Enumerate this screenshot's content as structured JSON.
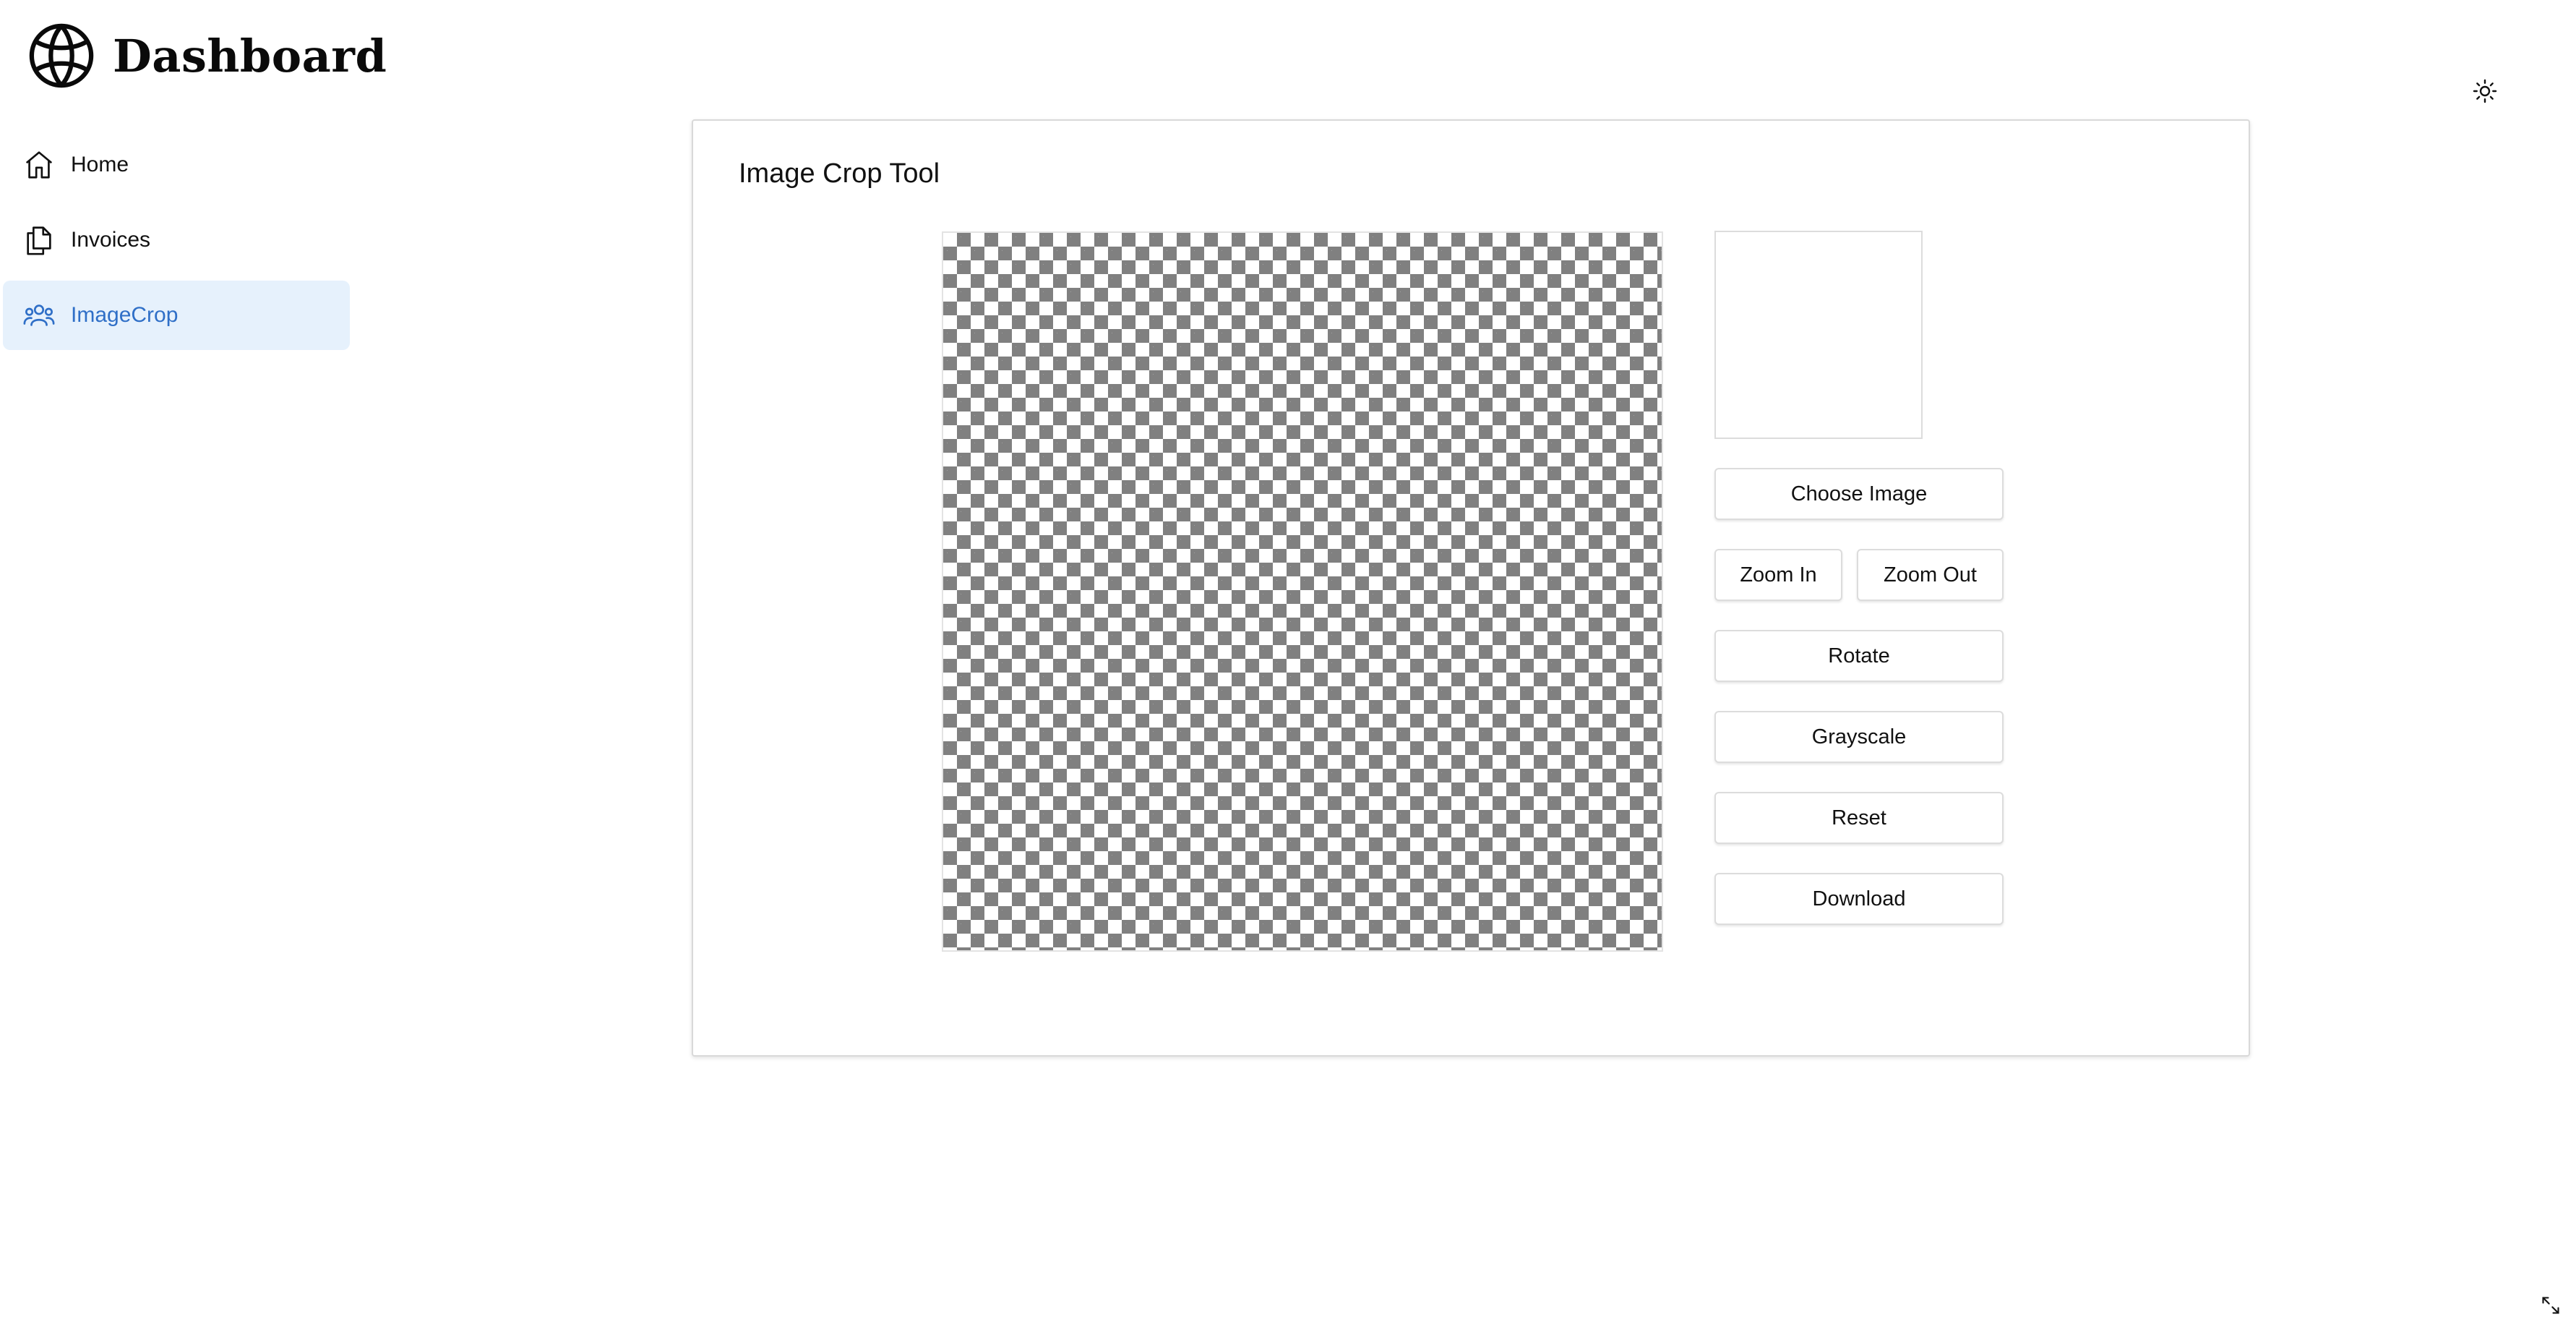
{
  "app": {
    "title": "Dashboard",
    "logo_icon": "globe-icon",
    "theme_toggle_icon": "sun-icon"
  },
  "sidebar": {
    "items": [
      {
        "label": "Home",
        "icon": "home-icon",
        "active": false
      },
      {
        "label": "Invoices",
        "icon": "documents-icon",
        "active": false
      },
      {
        "label": "ImageCrop",
        "icon": "users-icon",
        "active": true
      }
    ]
  },
  "main": {
    "card_title": "Image Crop Tool",
    "buttons": {
      "choose_image": "Choose Image",
      "zoom_in": "Zoom In",
      "zoom_out": "Zoom Out",
      "rotate": "Rotate",
      "grayscale": "Grayscale",
      "reset": "Reset",
      "download": "Download"
    }
  },
  "colors": {
    "accent": "#2f6fc7",
    "active_bg": "#e6f1fc",
    "checker": "#808080"
  },
  "corner_icon": "expand-icon"
}
